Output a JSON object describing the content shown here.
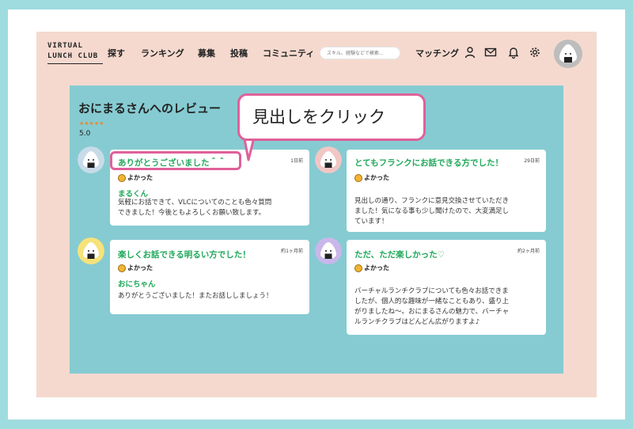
{
  "header": {
    "logo_line1": "VIRTUAL",
    "logo_line2": "LUNCH CLUB",
    "nav": [
      "探す",
      "ランキング",
      "募集",
      "投稿",
      "コミュニティ"
    ],
    "search_placeholder": "スキル、経験などで検索...",
    "matching": "マッチング",
    "avatar_badge": "VLC"
  },
  "main": {
    "title": "おにまるさんへのレビュー",
    "stars": "★★★★★",
    "score": "5.0"
  },
  "callout": {
    "text": "見出しをクリック"
  },
  "reviews": [
    {
      "title": "ありがとうございました＾＾",
      "time": "1日前",
      "rating": "よかった",
      "name": "まるくん",
      "body": [
        "気軽にお話できて、VLCについてのことも色々質問",
        "できました！今後ともよろしくお願い致します。"
      ],
      "avatar_badge": "VLC"
    },
    {
      "title": "とてもフランクにお話できる方でした！",
      "time": "29日前",
      "rating": "よかった",
      "name": "",
      "body": [
        "見出しの通り、フランクに意見交換させていただき",
        "ました！気になる事も少し聞けたので、大変満足し",
        "ています！"
      ],
      "avatar_badge": "VLC"
    },
    {
      "title": "楽しくお話できる明るい方でした！",
      "time": "約1ヶ月前",
      "rating": "よかった",
      "name": "おにちゃん",
      "body": [
        "ありがとうございました！またお話ししましょう！"
      ],
      "avatar_badge": "VLC"
    },
    {
      "title": "ただ、ただ楽しかった♡",
      "time": "約2ヶ月前",
      "rating": "よかった",
      "name": "",
      "body": [
        "バーチャルランチクラブについても色々お話できま",
        "したが、個人的な趣味が一緒なこともあり、盛り上",
        "がりましたね〜。おにまるさんの魅力で、バーチャ",
        "ルランチクラブはどんどん広がりますよ♪"
      ],
      "avatar_badge": "VLC"
    }
  ],
  "colors": {
    "outer": "#9fdcdf",
    "page": "#f5d9cf",
    "content": "#86cbd2",
    "accent_green": "#20a85a",
    "highlight_pink": "#e0609a"
  }
}
